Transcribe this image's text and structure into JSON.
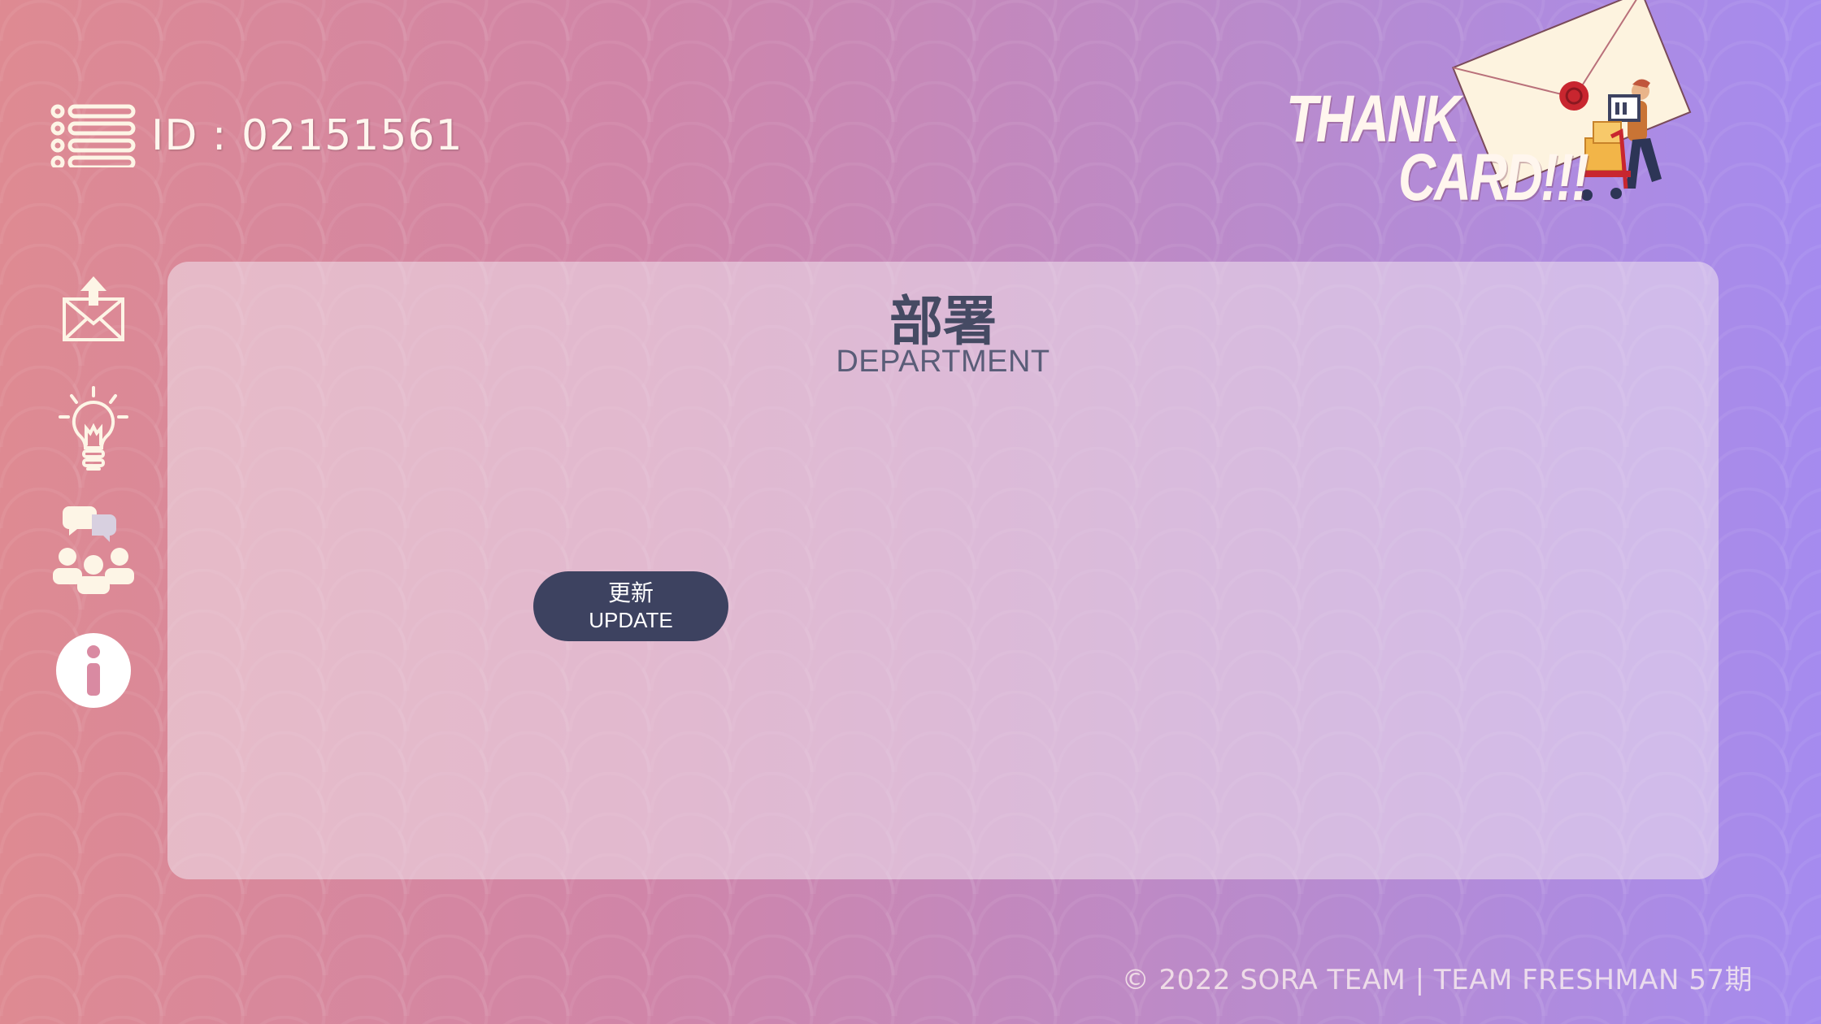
{
  "header": {
    "id_text": "ID : 02151561"
  },
  "logo": {
    "line1": "THANK",
    "line2": "CARD!!!"
  },
  "sidebar": {
    "items": [
      {
        "name": "send-mail",
        "icon": "mail-upload-icon"
      },
      {
        "name": "idea",
        "icon": "lightbulb-icon"
      },
      {
        "name": "team",
        "icon": "people-chat-icon"
      },
      {
        "name": "info",
        "icon": "info-icon"
      }
    ]
  },
  "panel": {
    "title": "部署",
    "subtitle": "DEPARTMENT",
    "update_button": {
      "label_jp": "更新",
      "label_en": "UPDATE"
    }
  },
  "footer": {
    "copyright": "© 2022 SORA TEAM | TEAM FRESHMAN 57期"
  },
  "colors": {
    "button_bg": "#3d4260",
    "icon_color": "#fdf5e6",
    "title_color": "#454a63"
  }
}
